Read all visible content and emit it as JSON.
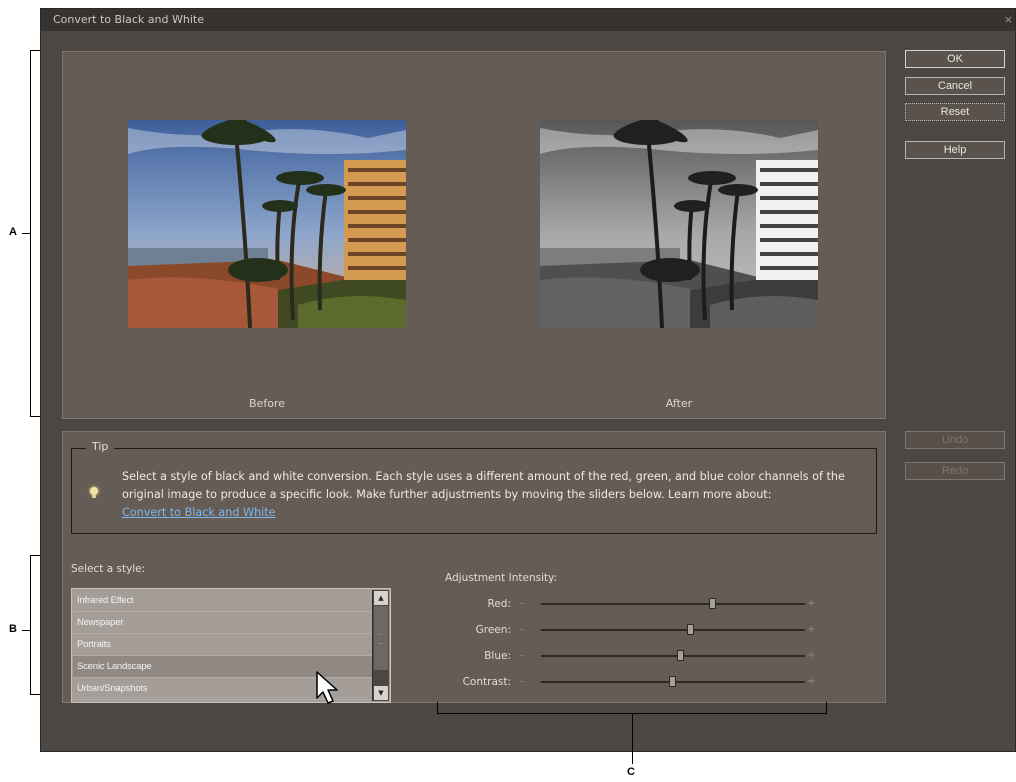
{
  "window": {
    "title": "Convert to Black and White"
  },
  "preview": {
    "before_label": "Before",
    "after_label": "After"
  },
  "buttons": {
    "ok": "OK",
    "cancel": "Cancel",
    "reset": "Reset",
    "help": "Help",
    "undo": "Undo",
    "redo": "Redo"
  },
  "tip": {
    "legend": "Tip",
    "text": "Select a style of black and white conversion. Each style uses a different amount of the red, green, and blue color channels of the original image to produce a specific look. Make further adjustments by moving the sliders below. Learn more about:",
    "link": "Convert to Black and White"
  },
  "styles": {
    "label": "Select a style:",
    "items": [
      "Infrared Effect",
      "Newspaper",
      "Portraits",
      "Scenic Landscape",
      "Urban/Snapshots"
    ],
    "selected": "Scenic Landscape"
  },
  "adjustments": {
    "label": "Adjustment Intensity:",
    "minus": "–",
    "plus": "+",
    "sliders": [
      {
        "label": "Red:",
        "value": 0.65
      },
      {
        "label": "Green:",
        "value": 0.57
      },
      {
        "label": "Blue:",
        "value": 0.53
      },
      {
        "label": "Contrast:",
        "value": 0.5
      }
    ]
  },
  "callouts": {
    "a": "A",
    "b": "B",
    "c": "C"
  },
  "colors": {
    "dialog_bg": "#4c4743",
    "panel_bg": "#655c56",
    "link": "#7db7ea"
  }
}
